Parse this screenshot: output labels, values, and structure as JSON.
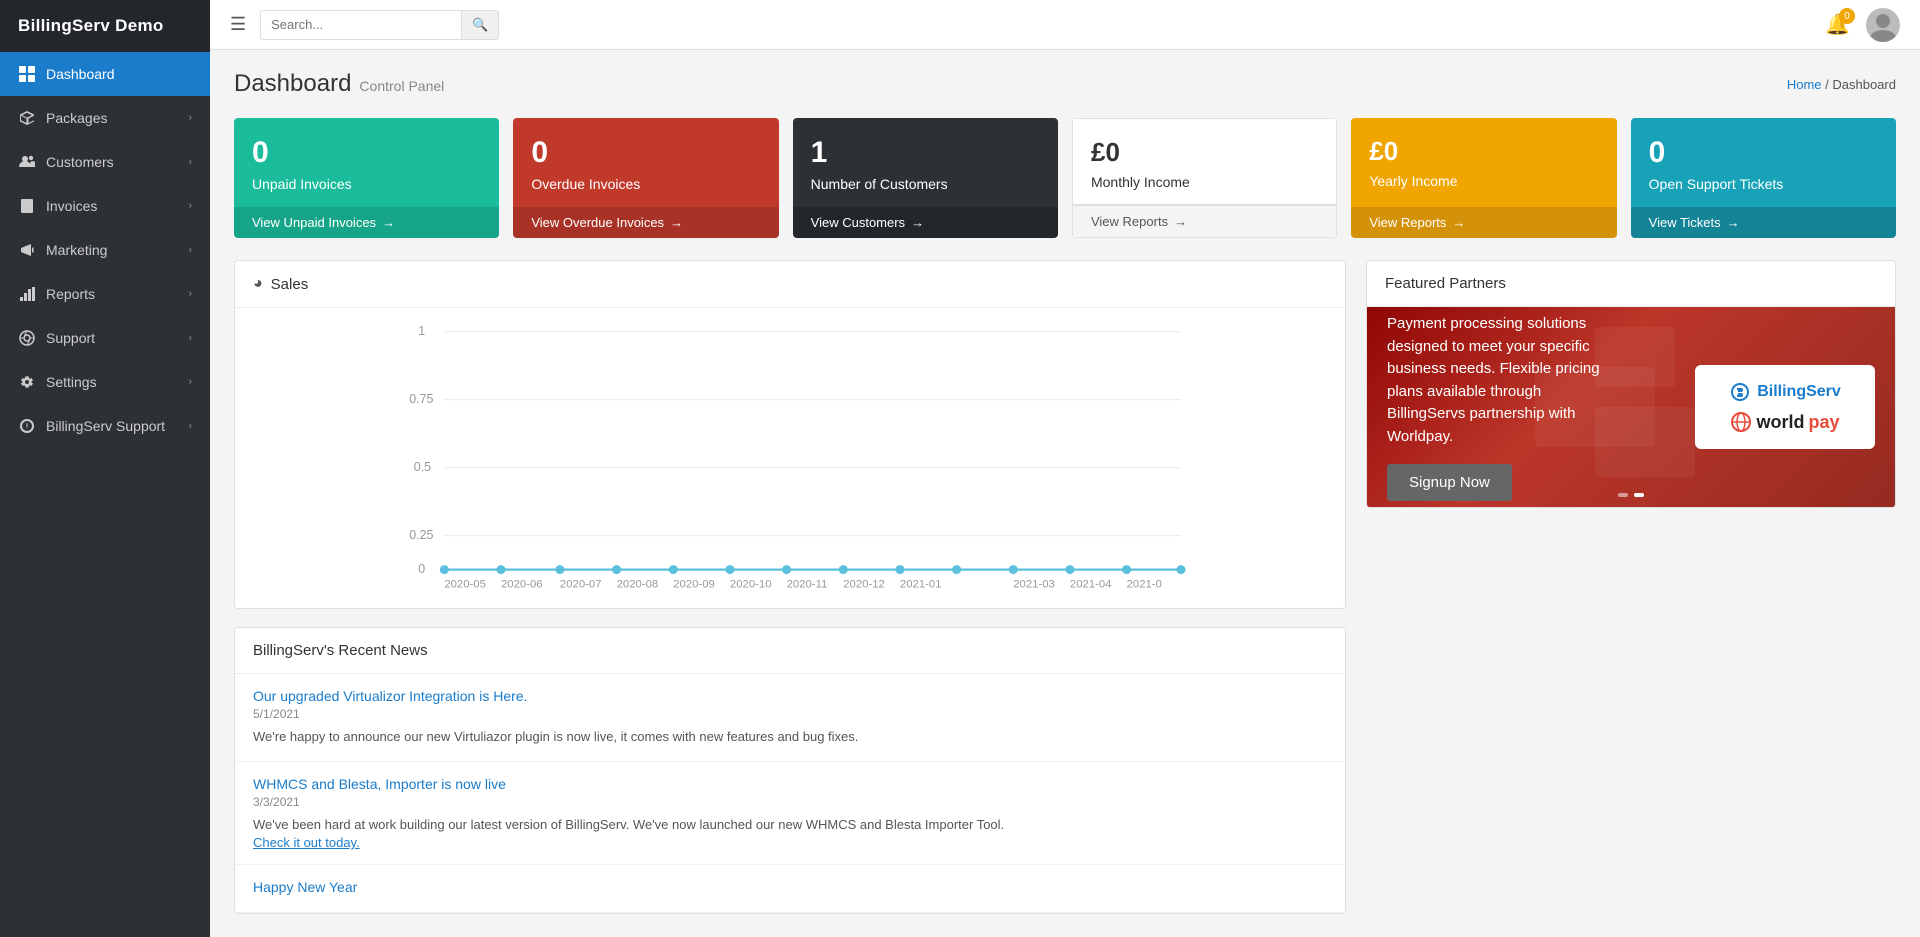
{
  "app": {
    "name": "BillingServ Demo"
  },
  "topbar": {
    "search_placeholder": "Search...",
    "bell_count": "0",
    "breadcrumb_home": "Home",
    "breadcrumb_current": "Dashboard"
  },
  "sidebar": {
    "items": [
      {
        "id": "dashboard",
        "label": "Dashboard",
        "icon": "dashboard-icon",
        "active": true,
        "has_chevron": false
      },
      {
        "id": "packages",
        "label": "Packages",
        "icon": "packages-icon",
        "active": false,
        "has_chevron": true
      },
      {
        "id": "customers",
        "label": "Customers",
        "icon": "customers-icon",
        "active": false,
        "has_chevron": true
      },
      {
        "id": "invoices",
        "label": "Invoices",
        "icon": "invoices-icon",
        "active": false,
        "has_chevron": true
      },
      {
        "id": "marketing",
        "label": "Marketing",
        "icon": "marketing-icon",
        "active": false,
        "has_chevron": true
      },
      {
        "id": "reports",
        "label": "Reports",
        "icon": "reports-icon",
        "active": false,
        "has_chevron": true
      },
      {
        "id": "support",
        "label": "Support",
        "icon": "support-icon",
        "active": false,
        "has_chevron": true
      },
      {
        "id": "settings",
        "label": "Settings",
        "icon": "settings-icon",
        "active": false,
        "has_chevron": true
      },
      {
        "id": "billingserv-support",
        "label": "BillingServ Support",
        "icon": "billingserv-support-icon",
        "active": false,
        "has_chevron": true
      }
    ]
  },
  "page": {
    "title": "Dashboard",
    "subtitle": "Control Panel"
  },
  "stat_cards": [
    {
      "id": "unpaid-invoices",
      "number": "0",
      "label": "Unpaid Invoices",
      "footer_label": "View Unpaid Invoices",
      "card_class": "card-teal"
    },
    {
      "id": "overdue-invoices",
      "number": "0",
      "label": "Overdue Invoices",
      "footer_label": "View Overdue Invoices",
      "card_class": "card-red"
    },
    {
      "id": "number-of-customers",
      "number": "1",
      "label": "Number of Customers",
      "footer_label": "View Customers",
      "card_class": "card-dark"
    },
    {
      "id": "monthly-income",
      "number": "£0",
      "label": "Monthly Income",
      "footer_label": "View Reports",
      "card_class": "card-light"
    },
    {
      "id": "yearly-income",
      "number": "£0",
      "label": "Yearly Income",
      "footer_label": "View Reports",
      "card_class": "card-yellow"
    },
    {
      "id": "open-support-tickets",
      "number": "0",
      "label": "Open Support Tickets",
      "footer_label": "View Tickets",
      "card_class": "card-cyan"
    }
  ],
  "sales_chart": {
    "title": "Sales",
    "x_labels": [
      "2020-05",
      "2020-06",
      "2020-07",
      "2020-08",
      "2020-09",
      "2020-10",
      "2020-11",
      "2020-12",
      "2021-01",
      "",
      "2021-03",
      "2021-04",
      "2021-0"
    ],
    "y_labels": [
      "1",
      "0.75",
      "0.5",
      "0.25",
      "0"
    ]
  },
  "news": {
    "title": "BillingServ's Recent News",
    "items": [
      {
        "title": "Our upgraded Virtualizor Integration is Here.",
        "date": "5/1/2021",
        "body": "We're happy to announce our new Virtuliazor plugin is now live, it comes with new features and bug fixes.",
        "link": null
      },
      {
        "title": "WHMCS and Blesta, Importer is now live",
        "date": "3/3/2021",
        "body": "We've been hard at work building our latest version of BillingServ. We've now launched our new WHMCS and Blesta Importer Tool.",
        "link": "Check it out today."
      },
      {
        "title": "Happy New Year",
        "date": null,
        "body": null,
        "link": null
      }
    ]
  },
  "featured_partners": {
    "title": "Featured Partners",
    "banner_text": "Payment processing solutions designed to meet your specific business needs. Flexible pricing plans available through BillingServs partnership with Worldpay.",
    "signup_label": "Signup Now",
    "billingserv_label": "BillingServ",
    "worldpay_label_black": "world",
    "worldpay_label_red": "pay"
  }
}
